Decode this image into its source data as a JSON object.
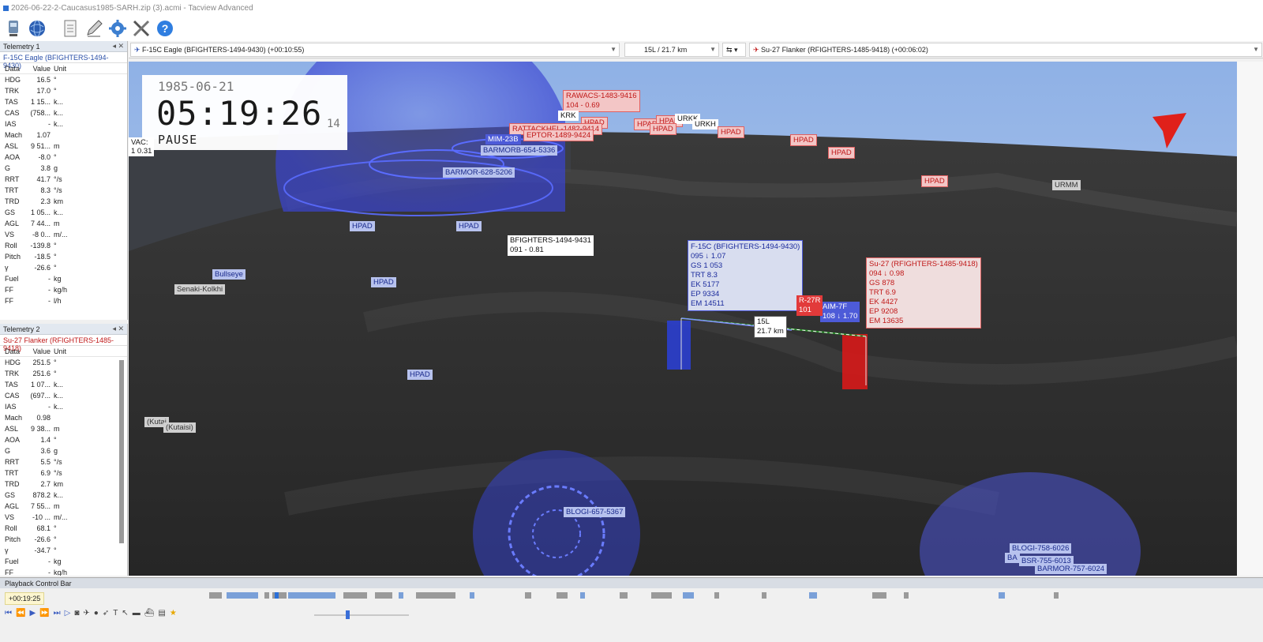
{
  "window": {
    "title": "2026-06-22-2-Caucasus1985-SARH.zip (3).acmi - Tacview Advanced"
  },
  "toolbar": {
    "icons": [
      "recorder-icon",
      "globe-icon",
      "document-icon",
      "pen-icon",
      "gear-icon",
      "tools-icon",
      "help-icon"
    ]
  },
  "selector": {
    "primary": "F-15C Eagle (BFIGHTERS-1494-9430) (+00:10:55)",
    "range": "15L / 21.7 km",
    "secondary": "Su-27 Flanker (RFIGHTERS-1485-9418) (+00:06:02)"
  },
  "telemetry1": {
    "title": "Telemetry 1",
    "object": "F-15C Eagle (BFIGHTERS-1494-9430)",
    "headers": [
      "Data",
      "Value",
      "Unit"
    ],
    "rows": [
      [
        "HDG",
        "16.5",
        "°"
      ],
      [
        "TRK",
        "17.0",
        "°"
      ],
      [
        "TAS",
        "1 15...",
        "k..."
      ],
      [
        "CAS",
        "(758...",
        "k..."
      ],
      [
        "IAS",
        "-",
        "k..."
      ],
      [
        "Mach",
        "1.07",
        ""
      ],
      [
        "ASL",
        "9 51...",
        "m"
      ],
      [
        "AOA",
        "-8.0",
        "°"
      ],
      [
        "G",
        "3.8",
        "g"
      ],
      [
        "RRT",
        "41.7",
        "°/s"
      ],
      [
        "TRT",
        "8.3",
        "°/s"
      ],
      [
        "TRD",
        "2.3",
        "km"
      ],
      [
        "GS",
        "1 05...",
        "k..."
      ],
      [
        "AGL",
        "7 44...",
        "m"
      ],
      [
        "VS",
        "-8 0...",
        "m/..."
      ],
      [
        "Roll",
        "-139.8",
        "°"
      ],
      [
        "Pitch",
        "-18.5",
        "°"
      ],
      [
        "γ",
        "-26.6",
        "°"
      ],
      [
        "Fuel",
        "-",
        "kg"
      ],
      [
        "FF",
        "-",
        "kg/h"
      ],
      [
        "FF",
        "-",
        "l/h"
      ]
    ]
  },
  "telemetry2": {
    "title": "Telemetry 2",
    "object": "Su-27 Flanker (RFIGHTERS-1485-9418)",
    "headers": [
      "Data",
      "Value",
      "Unit"
    ],
    "rows": [
      [
        "HDG",
        "251.5",
        "°"
      ],
      [
        "TRK",
        "251.6",
        "°"
      ],
      [
        "TAS",
        "1 07...",
        "k..."
      ],
      [
        "CAS",
        "(697...",
        "k..."
      ],
      [
        "IAS",
        "-",
        "k..."
      ],
      [
        "Mach",
        "0.98",
        ""
      ],
      [
        "ASL",
        "9 38...",
        "m"
      ],
      [
        "AOA",
        "1.4",
        "°"
      ],
      [
        "G",
        "3.6",
        "g"
      ],
      [
        "RRT",
        "5.5",
        "°/s"
      ],
      [
        "TRT",
        "6.9",
        "°/s"
      ],
      [
        "TRD",
        "2.7",
        "km"
      ],
      [
        "GS",
        "878.2",
        "k..."
      ],
      [
        "AGL",
        "7 55...",
        "m"
      ],
      [
        "VS",
        "-10 ...",
        "m/..."
      ],
      [
        "Roll",
        "68.1",
        "°"
      ],
      [
        "Pitch",
        "-26.6",
        "°"
      ],
      [
        "γ",
        "-34.7",
        "°"
      ],
      [
        "Fuel",
        "-",
        "kg"
      ],
      [
        "FF",
        "-",
        "kg/h"
      ]
    ]
  },
  "clock": {
    "date": "1985-06-21",
    "time": "05:19:26",
    "frac": "14",
    "state": "PAUSE"
  },
  "labels": {
    "rawacs": "RAWACS-1483-9416",
    "rawacs2": "104 - 0.69",
    "krk": "KRK",
    "urkh": "URKH",
    "urkk": "URKK",
    "hpad": "HPAD",
    "urmm": "URMM",
    "rattackhel": "RATTACKHEL-1482-9414",
    "rinterceptor": "EPTOR-1489-9424",
    "mim": "MIM-23B",
    "barmorb": "BARMORB-654-5336",
    "barmor628": "BARMOR-628-5206",
    "wac": "VAC:",
    "wac2": "1 0.31",
    "bf9431": "BFIGHTERS-1494-9431",
    "bf9431b": "091 - 0.81",
    "bullseye": "Bullseye",
    "senaki": "Senaki-Kolkhi",
    "kutaisi1": "(Kutai",
    "kutaisi2": "(Kutaisi)",
    "aim7f": "AIM-7F",
    "aim7f2": "108 ↓ 1.70",
    "r27": "R-27R",
    "r27b": "101",
    "range1": "15L",
    "range2": "21.7 km",
    "blogi657": "BLOGI-657-5367",
    "blogi758": "BLOGI-758-6026",
    "bsr755": "BSR-755-6013",
    "barmor757": "BARMOR-757-6024",
    "ba": "BA"
  },
  "f15box": "F-15C (BFIGHTERS-1494-9430)\n095 ↓ 1.07\nGS 1 053\nTRT 8.3\nEK 5177\nEP 9334\nEM 14511",
  "su27box": "Su-27 (RFIGHTERS-1485-9418)\n094 ↓ 0.98\nGS 878\nTRT 6.9\nEK 4427\nEP 9208\nEM 13635",
  "playback": {
    "title": "Playback Control Bar",
    "time": "+00:19:25"
  },
  "colors": {
    "blue_team": "#4d5bd8",
    "red_team": "#e23a3a",
    "sky": "#a9c2ea",
    "terrain": "#2b2b2b"
  }
}
